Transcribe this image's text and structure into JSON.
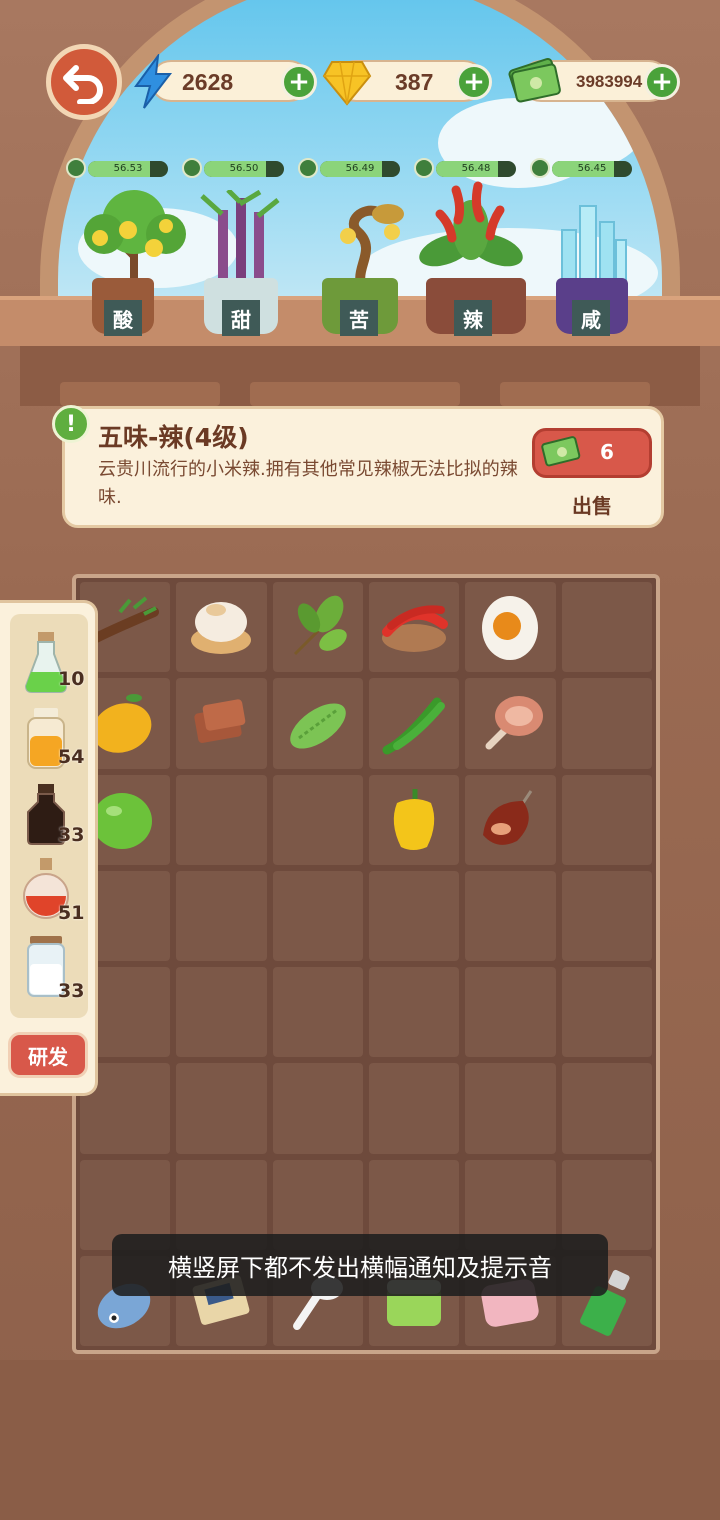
{
  "top_bar": {
    "energy_value": "2628",
    "gems_value": "387",
    "cash_value": "3983994"
  },
  "timers": [
    "56.53",
    "56.50",
    "56.49",
    "56.48",
    "56.45"
  ],
  "plants": [
    {
      "label": "酸"
    },
    {
      "label": "甜"
    },
    {
      "label": "苦"
    },
    {
      "label": "辣"
    },
    {
      "label": "咸"
    }
  ],
  "info": {
    "title": "五味-辣(4级)",
    "description": "云贵川流行的小米辣.拥有其他常见辣椒无法比拟的辣味.",
    "sell_count": "6",
    "sell_label": "出售"
  },
  "ingredients": [
    {
      "name": "tamarind",
      "count": "10"
    },
    {
      "name": "honey",
      "count": "54"
    },
    {
      "name": "soy-sauce",
      "count": "33"
    },
    {
      "name": "chili-oil",
      "count": "51"
    },
    {
      "name": "salt",
      "count": "33"
    }
  ],
  "research_label": "研发",
  "toast_text": "横竖屏下都不发出横幅通知及提示音",
  "colors": {
    "accent_red": "#d8584a",
    "accent_green": "#4aa23a",
    "panel_cream": "#fbf1dc"
  }
}
